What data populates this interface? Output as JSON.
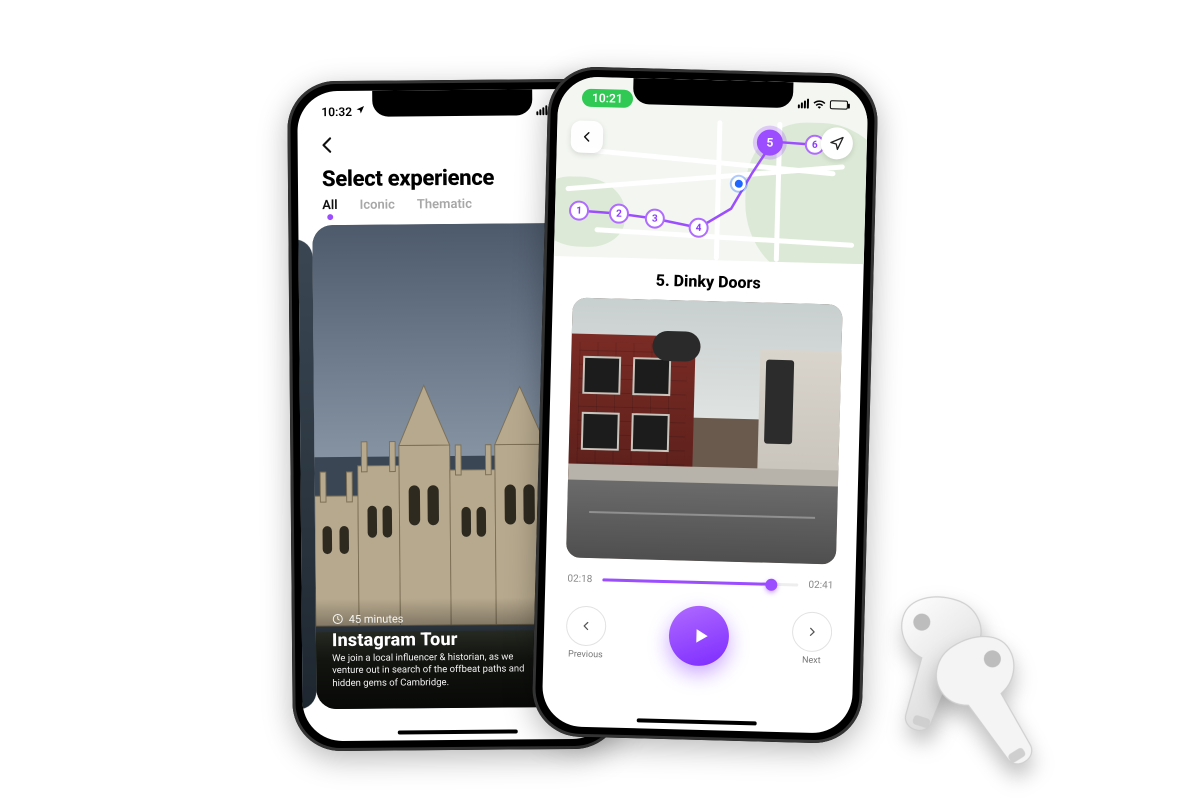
{
  "colors": {
    "accent": "#9b4dff",
    "accent2": "#7d2bff",
    "map_user": "#1e66ff"
  },
  "left_phone": {
    "status": {
      "time": "10:32",
      "network": "4G"
    },
    "header": {
      "title": "Select experience"
    },
    "tabs": [
      {
        "label": "All",
        "active": true
      },
      {
        "label": "Iconic",
        "active": false
      },
      {
        "label": "Thematic",
        "active": false
      }
    ],
    "card": {
      "duration": "45 minutes",
      "title": "Instagram Tour",
      "description": "We join a local influencer & historian, as we venture out in search of the offbeat paths and hidden gems of Cambridge."
    }
  },
  "right_phone": {
    "status": {
      "time": "10:21"
    },
    "map": {
      "waypoints": [
        "1",
        "2",
        "3",
        "4",
        "5",
        "6"
      ],
      "current": "5"
    },
    "stop": {
      "title": "5. Dinky Doors"
    },
    "player": {
      "elapsed": "02:18",
      "total": "02:41",
      "progress_pct": 86,
      "prev_label": "Previous",
      "next_label": "Next"
    }
  }
}
